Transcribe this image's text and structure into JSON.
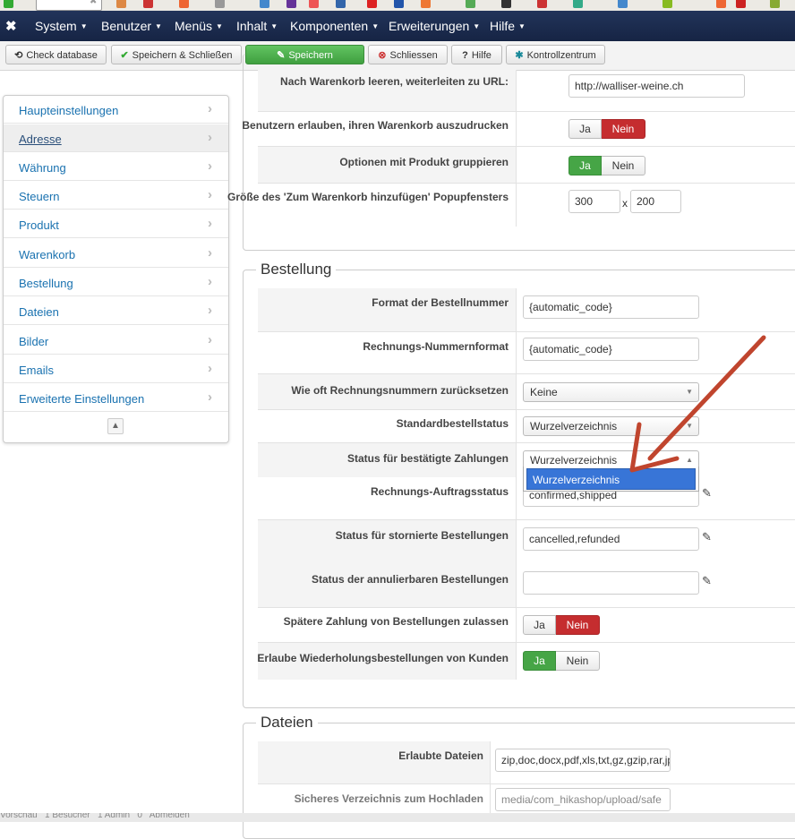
{
  "navbar": {
    "logo": "✖",
    "menus": [
      "System",
      "Benutzer",
      "Menüs",
      "Inhalt",
      "Komponenten",
      "Erweiterungen",
      "Hilfe"
    ]
  },
  "toolbar": {
    "check_database": "Check database",
    "save_close": "Speichern & Schließen",
    "save": "Speichern",
    "close": "Schliessen",
    "help": "Hilfe",
    "control_center": "Kontrollzentrum"
  },
  "sidebar": {
    "items": [
      {
        "label": "Haupteinstellungen"
      },
      {
        "label": "Adresse"
      },
      {
        "label": "Währung"
      },
      {
        "label": "Steuern"
      },
      {
        "label": "Produkt"
      },
      {
        "label": "Warenkorb"
      },
      {
        "label": "Bestellung"
      },
      {
        "label": "Dateien"
      },
      {
        "label": "Bilder"
      },
      {
        "label": "Emails"
      },
      {
        "label": "Erweiterte Einstellungen"
      }
    ]
  },
  "cart": {
    "redirect_label": "Nach Warenkorb leeren, weiterleiten zu URL:",
    "redirect_value": "http://walliser-weine.ch",
    "print_label": "Benutzern erlauben, ihren Warenkorb auszudrucken",
    "group_label": "Optionen mit Produkt gruppieren",
    "popup_label": "Größe des 'Zum Warenkorb hinzufügen' Popupfensters",
    "popup_w": "300",
    "popup_x": "x",
    "popup_h": "200"
  },
  "toggle": {
    "yes": "Ja",
    "no": "Nein"
  },
  "order": {
    "legend": "Bestellung",
    "format_label": "Format der Bestellnummer",
    "format_value": "{automatic_code}",
    "invoice_label": "Rechnungs-Nummernformat",
    "invoice_value": "{automatic_code}",
    "reset_label": "Wie oft Rechnungsnummern zurücksetzen",
    "reset_value": "Keine",
    "default_status_label": "Standardbestellstatus",
    "default_status_value": "Wurzelverzeichnis",
    "confirmed_label": "Status für bestätigte Zahlungen",
    "confirmed_value": "Wurzelverzeichnis",
    "confirmed_option": "Wurzelverzeichnis",
    "invoice_status_label": "Rechnungs-Auftragsstatus",
    "invoice_status_value": "confirmed,shipped",
    "cancelled_label": "Status für stornierte Bestellungen",
    "cancelled_value": "cancelled,refunded",
    "cancellable_label": "Status der annulierbaren Bestellungen",
    "cancellable_value": "",
    "later_payment_label": "Spätere Zahlung von Bestellungen zulassen",
    "repeat_label": "Erlaube Wiederholungsbestellungen von Kunden"
  },
  "files": {
    "legend": "Dateien",
    "allowed_label": "Erlaubte Dateien",
    "allowed_value": "zip,doc,docx,pdf,xls,txt,gz,gzip,rar,jp",
    "secure_label": "Sicheres Verzeichnis zum Hochladen",
    "secure_value": "media/com_hikashop/upload/safe"
  },
  "statusbar": {
    "text": "Vorschau   1 Besucher   1 Admin   0   Abmelden"
  },
  "colors": {
    "navbar": "#1c2b4a",
    "link": "#1a72b0",
    "green": "#46a546",
    "red": "#c52d2f",
    "arrow": "#c0452e",
    "selection": "#3875d7"
  }
}
